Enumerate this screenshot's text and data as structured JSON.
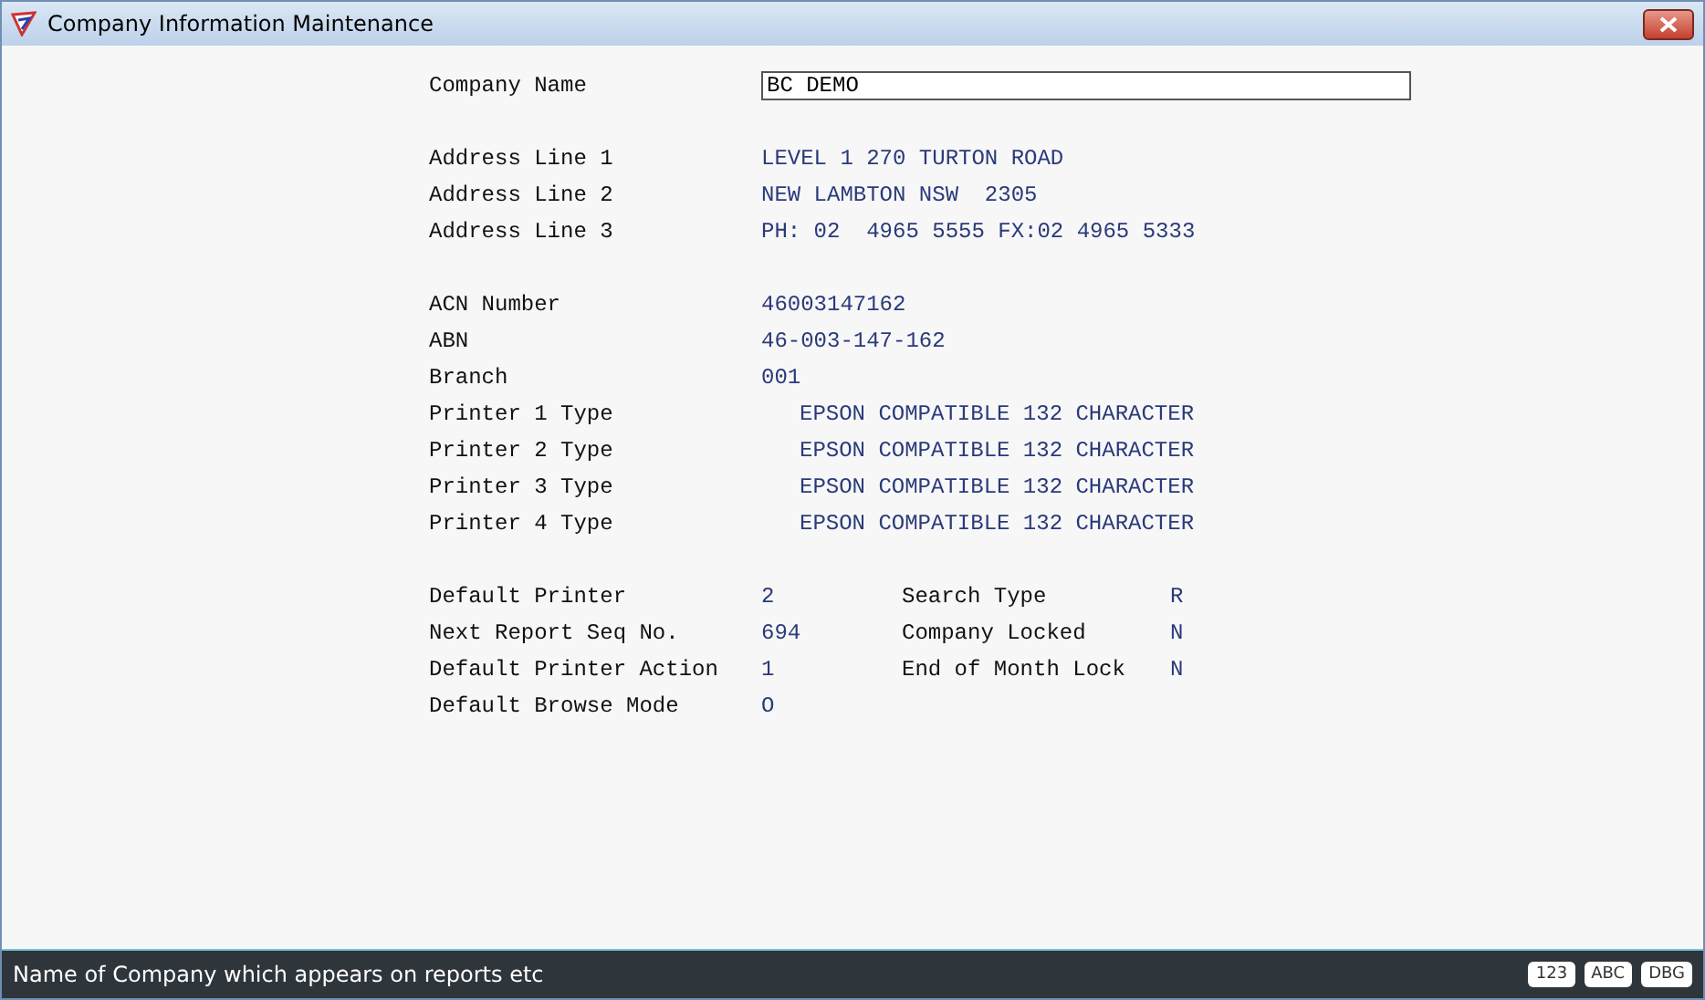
{
  "window": {
    "title": "Company Information Maintenance"
  },
  "company_name": {
    "label": "Company Name",
    "value": "BC DEMO"
  },
  "groups": [
    [
      {
        "label": "Address Line 1",
        "value": "LEVEL 1 270 TURTON ROAD",
        "kind": "plain"
      },
      {
        "label": "Address Line 2",
        "value": "NEW LAMBTON NSW  2305",
        "kind": "plain"
      },
      {
        "label": "Address Line 3",
        "value": "PH: 02  4965 5555 FX:02 4965 5333",
        "kind": "plain"
      }
    ],
    [
      {
        "label": "ACN Number",
        "value": "46003147162",
        "kind": "plain"
      },
      {
        "label": "ABN",
        "value": "46-003-147-162",
        "kind": "plain"
      },
      {
        "label": "Branch",
        "value": "001",
        "kind": "plain"
      },
      {
        "label": "Printer 1 Type",
        "value": "EPSON COMPATIBLE 132 CHARACTER",
        "kind": "indented"
      },
      {
        "label": "Printer 2 Type",
        "value": "EPSON COMPATIBLE 132 CHARACTER",
        "kind": "indented"
      },
      {
        "label": "Printer 3 Type",
        "value": "EPSON COMPATIBLE 132 CHARACTER",
        "kind": "indented"
      },
      {
        "label": "Printer 4 Type",
        "value": "EPSON COMPATIBLE 132 CHARACTER",
        "kind": "indented"
      }
    ]
  ],
  "settings": [
    {
      "label": "Default Printer",
      "value": "2",
      "label_2": "Search Type",
      "value_2": "R"
    },
    {
      "label": "Next Report Seq No.",
      "value": "694",
      "label_2": "Company Locked",
      "value_2": "N"
    },
    {
      "label": "Default Printer Action",
      "value": "1",
      "label_2": "End of Month Lock",
      "value_2": "N"
    },
    {
      "label": "Default Browse Mode",
      "value": "O"
    }
  ],
  "status_bar": {
    "hint": "Name of Company which appears on reports etc",
    "indicators": [
      "123",
      "ABC",
      "DBG"
    ]
  }
}
